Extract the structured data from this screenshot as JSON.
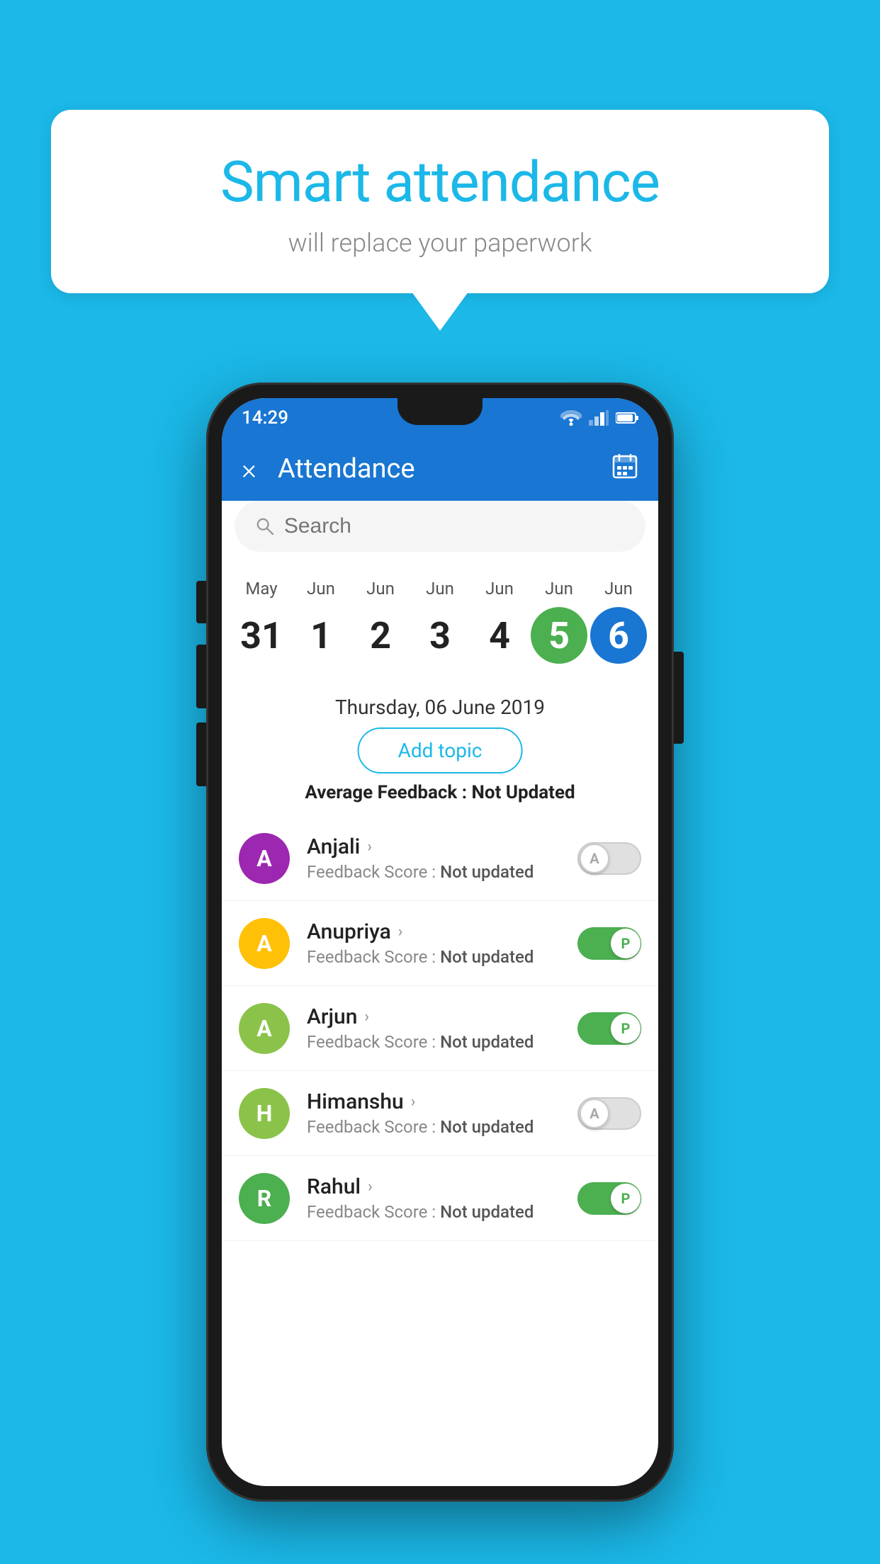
{
  "background_color": "#1BB8E8",
  "speech_bubble": {
    "title": "Smart attendance",
    "subtitle": "will replace your paperwork"
  },
  "status_bar": {
    "time": "14:29"
  },
  "app_bar": {
    "title": "Attendance",
    "close_icon": "×",
    "calendar_icon": "📅"
  },
  "search": {
    "placeholder": "Search"
  },
  "calendar": {
    "days": [
      {
        "month": "May",
        "date": "31",
        "style": "normal"
      },
      {
        "month": "Jun",
        "date": "1",
        "style": "normal"
      },
      {
        "month": "Jun",
        "date": "2",
        "style": "normal"
      },
      {
        "month": "Jun",
        "date": "3",
        "style": "normal"
      },
      {
        "month": "Jun",
        "date": "4",
        "style": "normal"
      },
      {
        "month": "Jun",
        "date": "5",
        "style": "today"
      },
      {
        "month": "Jun",
        "date": "6",
        "style": "selected"
      }
    ]
  },
  "selected_date": "Thursday, 06 June 2019",
  "add_topic_label": "Add topic",
  "avg_feedback_label": "Average Feedback :",
  "avg_feedback_value": "Not Updated",
  "students": [
    {
      "name": "Anjali",
      "avatar_letter": "A",
      "avatar_color": "#9C27B0",
      "feedback_label": "Feedback Score :",
      "feedback_value": "Not updated",
      "toggle_state": "off",
      "toggle_label": "A"
    },
    {
      "name": "Anupriya",
      "avatar_letter": "A",
      "avatar_color": "#FFC107",
      "feedback_label": "Feedback Score :",
      "feedback_value": "Not updated",
      "toggle_state": "on",
      "toggle_label": "P"
    },
    {
      "name": "Arjun",
      "avatar_letter": "A",
      "avatar_color": "#8BC34A",
      "feedback_label": "Feedback Score :",
      "feedback_value": "Not updated",
      "toggle_state": "on",
      "toggle_label": "P"
    },
    {
      "name": "Himanshu",
      "avatar_letter": "H",
      "avatar_color": "#8BC34A",
      "feedback_label": "Feedback Score :",
      "feedback_value": "Not updated",
      "toggle_state": "off",
      "toggle_label": "A"
    },
    {
      "name": "Rahul",
      "avatar_letter": "R",
      "avatar_color": "#4CAF50",
      "feedback_label": "Feedback Score :",
      "feedback_value": "Not updated",
      "toggle_state": "on",
      "toggle_label": "P"
    }
  ]
}
